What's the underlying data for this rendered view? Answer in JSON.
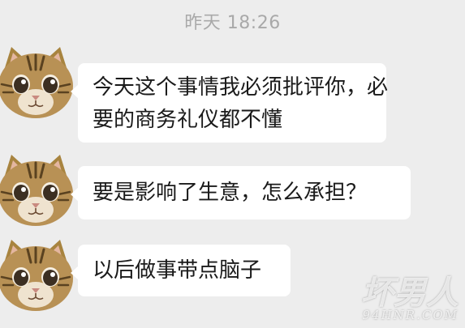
{
  "chat": {
    "timestamp": "昨天 18:26",
    "messages": [
      {
        "sender_avatar": "cat-avatar-icon",
        "lines": [
          "今天这个事情我必须批评你，必",
          "要的商务礼仪都不懂"
        ]
      },
      {
        "sender_avatar": "cat-avatar-icon",
        "lines": [
          "要是影响了生意，怎么承担？"
        ]
      },
      {
        "sender_avatar": "cat-avatar-icon",
        "lines": [
          "以后做事带点脑子"
        ]
      }
    ]
  },
  "watermark": {
    "text": "坏男人",
    "url": "94HNR.COM"
  },
  "colors": {
    "background": "#ededed",
    "bubble": "#ffffff",
    "timestamp": "#a9a9a9",
    "text": "#1a1a1a"
  }
}
